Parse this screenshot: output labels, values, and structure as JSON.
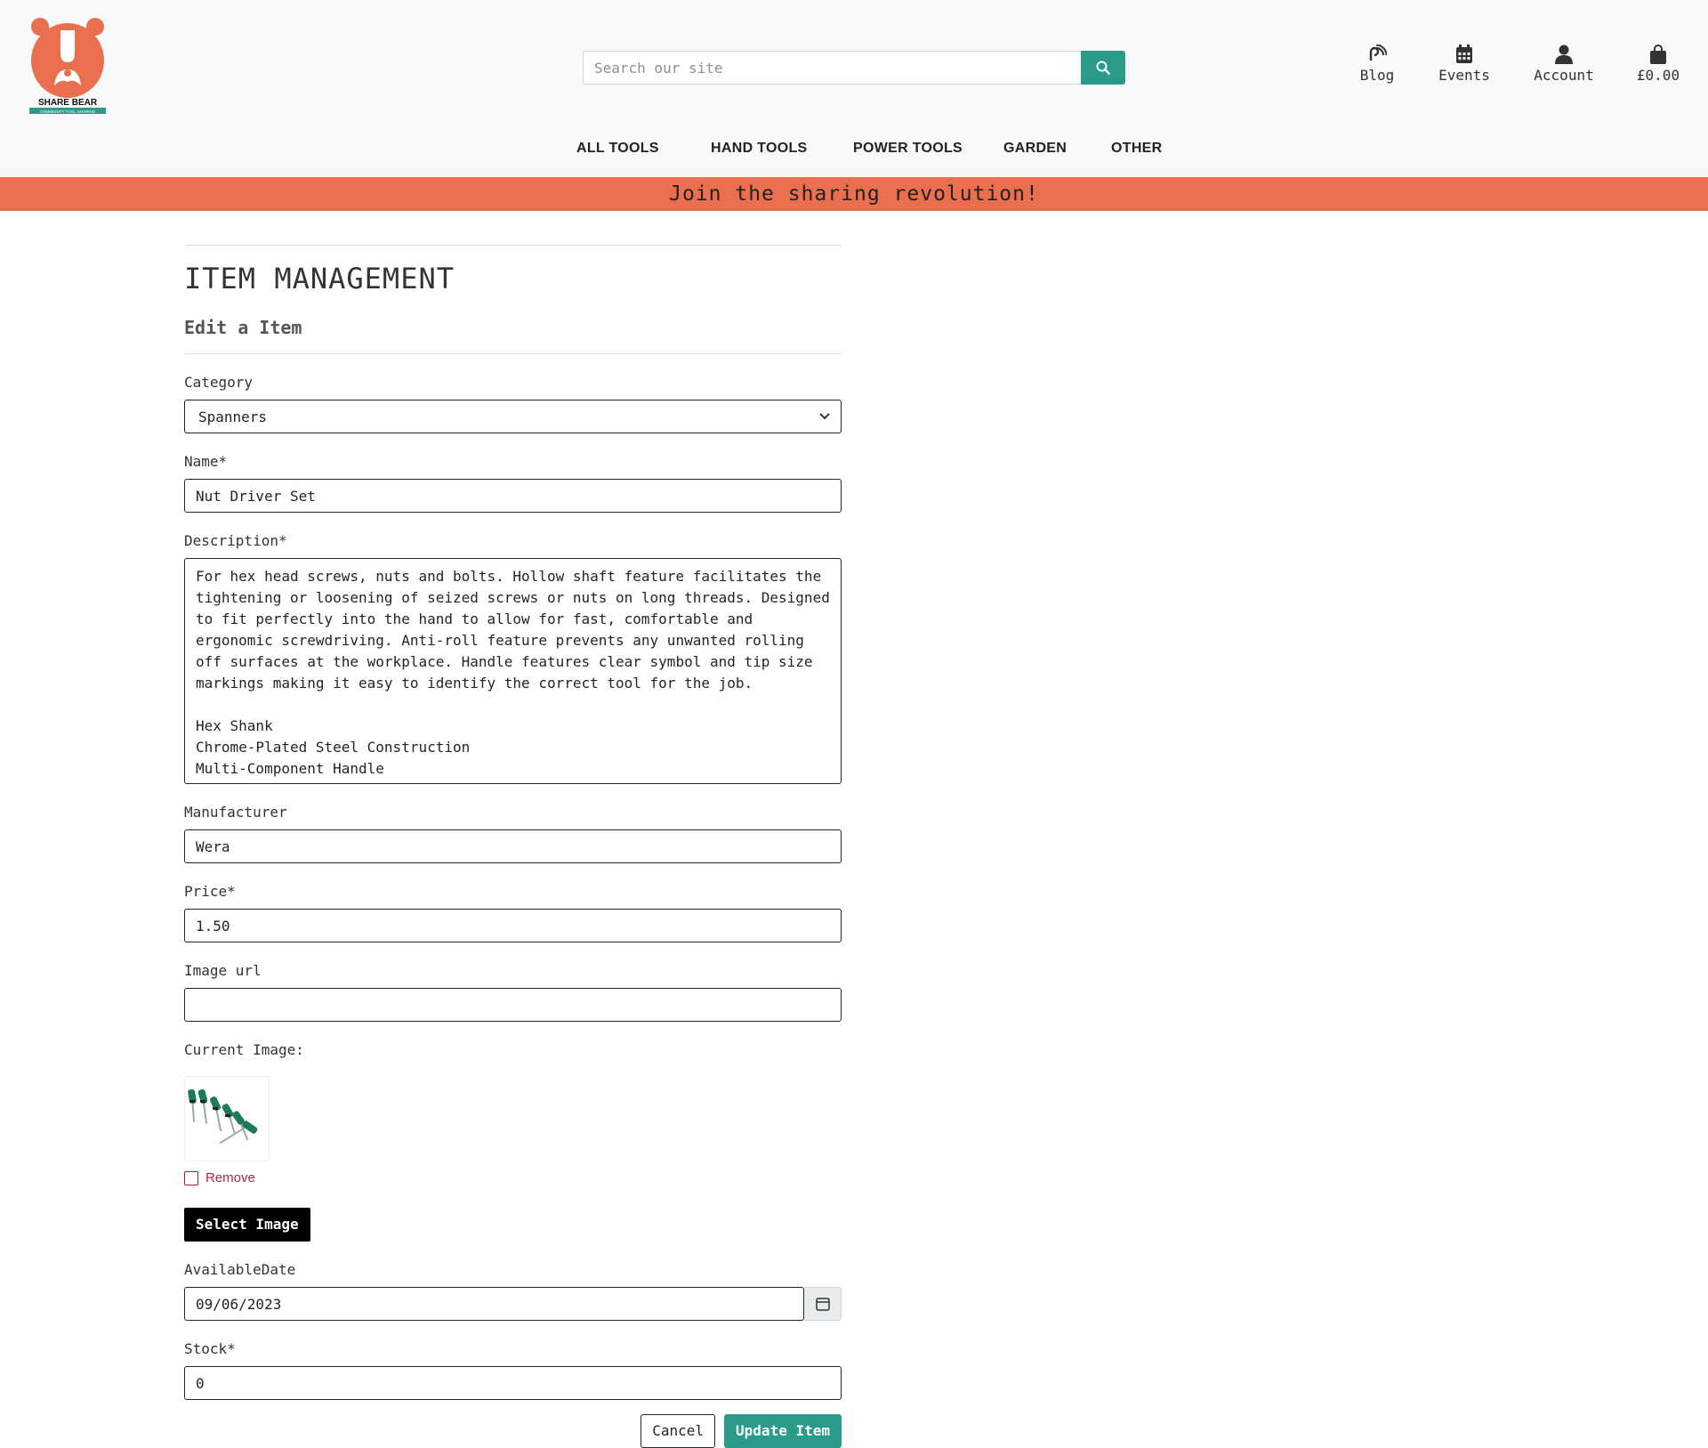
{
  "brand": {
    "logo_text": "SHARE BEAR",
    "logo_tagline": "COMMUNITY TOOL SHARING",
    "accent": "#e96f4f",
    "primary": "#2a9a8a"
  },
  "search": {
    "placeholder": "Search our site",
    "icon": "search-icon"
  },
  "top_links": {
    "blog": "Blog",
    "events": "Events",
    "account": "Account",
    "bag": "£0.00"
  },
  "nav": {
    "all_tools": "ALL TOOLS",
    "hand_tools": "HAND TOOLS",
    "power_tools": "POWER TOOLS",
    "garden": "GARDEN",
    "other": "OTHER"
  },
  "banner": "Join the sharing revolution!",
  "page": {
    "title": "ITEM MANAGEMENT",
    "subtitle": "Edit a Item"
  },
  "form": {
    "category_label": "Category",
    "category_value": "Spanners",
    "name_label": "Name*",
    "name_value": "Nut Driver Set",
    "description_label": "Description*",
    "description_value": "For hex head screws, nuts and bolts. Hollow shaft feature facilitates the tightening or loosening of seized screws or nuts on long threads. Designed to fit perfectly into the hand to allow for fast, comfortable and ergonomic screwdriving. Anti-roll feature prevents any unwanted rolling off surfaces at the workplace. Handle features clear symbol and tip size markings making it easy to identify the correct tool for the job.\n\nHex Shank\nChrome-Plated Steel Construction\nMulti-Component Handle",
    "manufacturer_label": "Manufacturer",
    "manufacturer_value": "Wera",
    "price_label": "Price*",
    "price_value": "1.50",
    "image_url_label": "Image url",
    "image_url_value": "",
    "current_image_label": "Current Image:",
    "remove_label": "Remove",
    "select_image_label": "Select Image",
    "available_date_label": "AvailableDate",
    "available_date_value": "09/06/2023",
    "stock_label": "Stock*",
    "stock_value": "0",
    "cancel_label": "Cancel",
    "update_label": "Update Item"
  }
}
